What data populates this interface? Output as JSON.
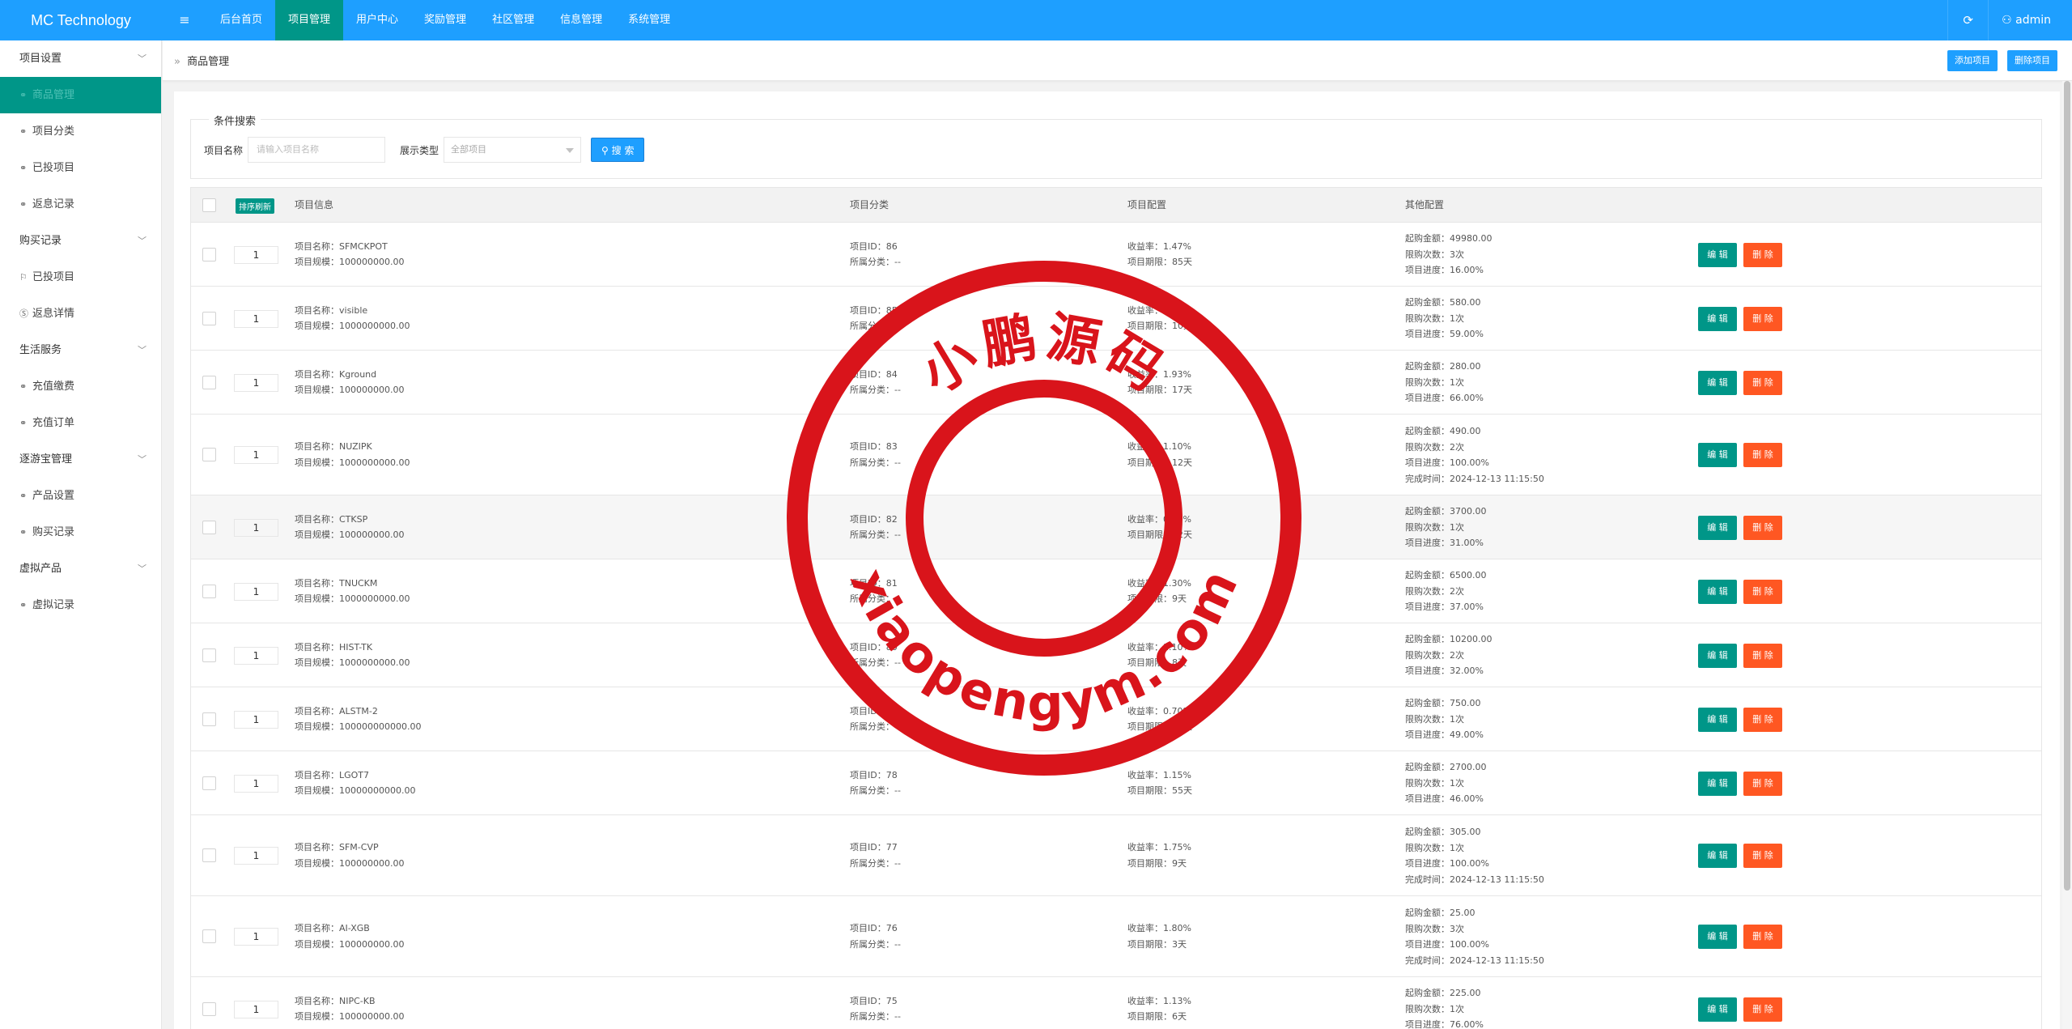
{
  "app": {
    "logo": "MC Technology",
    "menu_toggle": "≡",
    "refresh": "⟳",
    "user": "admin"
  },
  "topnav": [
    "后台首页",
    "项目管理",
    "用户中心",
    "奖励管理",
    "社区管理",
    "信息管理",
    "系统管理"
  ],
  "topnav_active": 1,
  "sidebar": [
    {
      "label": "项目设置",
      "type": "group"
    },
    {
      "label": "商品管理",
      "type": "sub",
      "icon": "link-icon",
      "active": true
    },
    {
      "label": "项目分类",
      "type": "sub",
      "icon": "link-icon"
    },
    {
      "label": "已投项目",
      "type": "sub",
      "icon": "link-icon"
    },
    {
      "label": "返息记录",
      "type": "sub",
      "icon": "link-icon"
    },
    {
      "label": "购买记录",
      "type": "group"
    },
    {
      "label": "已投项目",
      "type": "sub",
      "icon": "flag-icon"
    },
    {
      "label": "返息详情",
      "type": "sub",
      "icon": "dollar-icon"
    },
    {
      "label": "生活服务",
      "type": "group"
    },
    {
      "label": "充值缴费",
      "type": "sub",
      "icon": "link-icon"
    },
    {
      "label": "充值订单",
      "type": "sub",
      "icon": "link-icon"
    },
    {
      "label": "逐游宝管理",
      "type": "group"
    },
    {
      "label": "产品设置",
      "type": "sub",
      "icon": "link-icon"
    },
    {
      "label": "购买记录",
      "type": "sub",
      "icon": "link-icon"
    },
    {
      "label": "虚拟产品",
      "type": "group"
    },
    {
      "label": "虚拟记录",
      "type": "sub",
      "icon": "link-icon"
    }
  ],
  "breadcrumb": {
    "sep": "»",
    "label": "商品管理"
  },
  "header_buttons": {
    "add": "添加项目",
    "delete": "删除项目"
  },
  "search": {
    "legend": "条件搜索",
    "name_label": "项目名称",
    "name_placeholder": "请输入项目名称",
    "type_label": "展示类型",
    "type_value": "全部项目",
    "button": "搜 索"
  },
  "table": {
    "sort_badge": "排序刷新",
    "headers": [
      "项目信息",
      "项目分类",
      "项目配置",
      "其他配置"
    ],
    "edit_label": "编 辑",
    "delete_label": "删 除",
    "rows": [
      {
        "sort": "1",
        "name": "项目名称：SFMCKPOT",
        "scale": "项目规模：100000000.00",
        "pid": "项目ID：86",
        "cat": "所属分类：--",
        "rate": "收益率：1.47%",
        "term": "项目期限：85天",
        "other": [
          "起购金额：49980.00",
          "限购次数：3次",
          "项目进度：16.00%"
        ]
      },
      {
        "sort": "1",
        "name": "项目名称：visible",
        "scale": "项目规模：1000000000.00",
        "pid": "项目ID：85",
        "cat": "所属分类：--",
        "rate": "收益率：1.20%",
        "term": "项目期限：10天",
        "other": [
          "起购金额：580.00",
          "限购次数：1次",
          "项目进度：59.00%"
        ]
      },
      {
        "sort": "1",
        "name": "项目名称：Kground",
        "scale": "项目规模：100000000.00",
        "pid": "项目ID：84",
        "cat": "所属分类：--",
        "rate": "收益率：1.93%",
        "term": "项目期限：17天",
        "other": [
          "起购金额：280.00",
          "限购次数：1次",
          "项目进度：66.00%"
        ]
      },
      {
        "sort": "1",
        "name": "项目名称：NUZIPK",
        "scale": "项目规模：1000000000.00",
        "pid": "项目ID：83",
        "cat": "所属分类：--",
        "rate": "收益率：1.10%",
        "term": "项目期限：12天",
        "other": [
          "起购金额：490.00",
          "限购次数：2次",
          "项目进度：100.00%",
          "完成时间：2024-12-13 11:15:50"
        ]
      },
      {
        "sort": "1",
        "name": "项目名称：CTKSP",
        "scale": "项目规模：100000000.00",
        "pid": "项目ID：82",
        "cat": "所属分类：--",
        "rate": "收益率：0.90%",
        "term": "项目期限：12天",
        "other": [
          "起购金额：3700.00",
          "限购次数：1次",
          "项目进度：31.00%"
        ],
        "hl": true
      },
      {
        "sort": "1",
        "name": "项目名称：TNUCKM",
        "scale": "项目规模：1000000000.00",
        "pid": "项目ID：81",
        "cat": "所属分类：--",
        "rate": "收益率：1.30%",
        "term": "项目期限：9天",
        "other": [
          "起购金额：6500.00",
          "限购次数：2次",
          "项目进度：37.00%"
        ]
      },
      {
        "sort": "1",
        "name": "项目名称：HIST-TK",
        "scale": "项目规模：1000000000.00",
        "pid": "项目ID：80",
        "cat": "所属分类：--",
        "rate": "收益率：1.10%",
        "term": "项目期限：8天",
        "other": [
          "起购金额：10200.00",
          "限购次数：2次",
          "项目进度：32.00%"
        ]
      },
      {
        "sort": "1",
        "name": "项目名称：ALSTM-2",
        "scale": "项目规模：100000000000.00",
        "pid": "项目ID：79",
        "cat": "所属分类：--",
        "rate": "收益率：0.70%",
        "term": "项目期限：16天",
        "other": [
          "起购金额：750.00",
          "限购次数：1次",
          "项目进度：49.00%"
        ]
      },
      {
        "sort": "1",
        "name": "项目名称：LGOT7",
        "scale": "项目规模：10000000000.00",
        "pid": "项目ID：78",
        "cat": "所属分类：--",
        "rate": "收益率：1.15%",
        "term": "项目期限：55天",
        "other": [
          "起购金额：2700.00",
          "限购次数：1次",
          "项目进度：46.00%"
        ]
      },
      {
        "sort": "1",
        "name": "项目名称：SFM-CVP",
        "scale": "项目规模：100000000.00",
        "pid": "项目ID：77",
        "cat": "所属分类：--",
        "rate": "收益率：1.75%",
        "term": "项目期限：9天",
        "other": [
          "起购金额：305.00",
          "限购次数：1次",
          "项目进度：100.00%",
          "完成时间：2024-12-13 11:15:50"
        ]
      },
      {
        "sort": "1",
        "name": "项目名称：AI-XGB",
        "scale": "项目规模：100000000.00",
        "pid": "项目ID：76",
        "cat": "所属分类：--",
        "rate": "收益率：1.80%",
        "term": "项目期限：3天",
        "other": [
          "起购金额：25.00",
          "限购次数：3次",
          "项目进度：100.00%",
          "完成时间：2024-12-13 11:15:50"
        ]
      },
      {
        "sort": "1",
        "name": "项目名称：NIPC-KB",
        "scale": "项目规模：100000000.00",
        "pid": "项目ID：75",
        "cat": "所属分类：--",
        "rate": "收益率：1.13%",
        "term": "项目期限：6天",
        "other": [
          "起购金额：225.00",
          "限购次数：1次",
          "项目进度：76.00%"
        ]
      }
    ]
  },
  "watermark": {
    "top_text": "小鹏源码",
    "bottom_text": "xiaopengym.com",
    "color": "#d9141b"
  }
}
